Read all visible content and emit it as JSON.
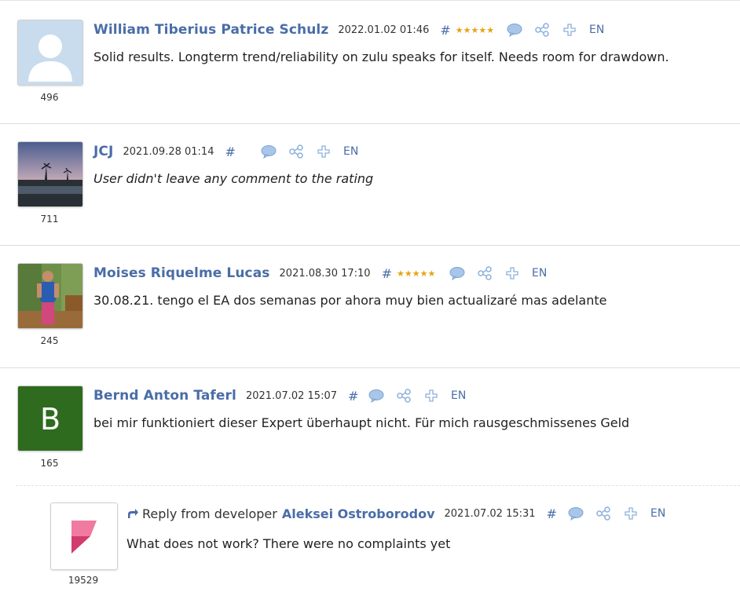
{
  "reviews": [
    {
      "author": "William Tiberius Patrice Schulz",
      "date": "2022.01.02 01:46",
      "hash": "#",
      "stars": 5,
      "lang": "EN",
      "text": "Solid results. Longterm trend/reliability on zulu speaks for itself. Needs room for drawdown.",
      "reputation": "496",
      "avatar": "default-silhouette"
    },
    {
      "author": "JCJ",
      "date": "2021.09.28 01:14",
      "hash": "#",
      "stars": 0,
      "lang": "EN",
      "text": "User didn't leave any comment to the rating",
      "reputation": "711",
      "avatar": "sunset-photo"
    },
    {
      "author": "Moises Riquelme Lucas",
      "date": "2021.08.30 17:10",
      "hash": "#",
      "stars": 5,
      "lang": "EN",
      "text": "30.08.21. tengo el EA dos semanas por ahora muy bien actualizaré mas adelante",
      "reputation": "245",
      "avatar": "person-photo"
    },
    {
      "author": "Bernd Anton Taferl",
      "date": "2021.07.02 15:07",
      "hash": "#",
      "stars": 0,
      "lang": "EN",
      "text": "bei mir funktioniert dieser Expert überhaupt nicht. Für mich rausgeschmissenes Geld",
      "reputation": "165",
      "avatar_letter": "B",
      "avatar_color": "#2e6b1e"
    }
  ],
  "reply": {
    "prefix": "Reply from developer",
    "author": "Aleksei Ostroborodov",
    "date": "2021.07.02 15:31",
    "hash": "#",
    "lang": "EN",
    "text": "What does not work? There were no complaints yet",
    "reputation": "19529",
    "avatar": "pink-flag-logo"
  },
  "colors": {
    "link": "#4a6da7",
    "star": "#e6a312",
    "icon": "#8ab0dc"
  },
  "icons": [
    "comment-icon",
    "share-icon",
    "plus-icon",
    "reply-arrow-icon",
    "star-icon"
  ]
}
